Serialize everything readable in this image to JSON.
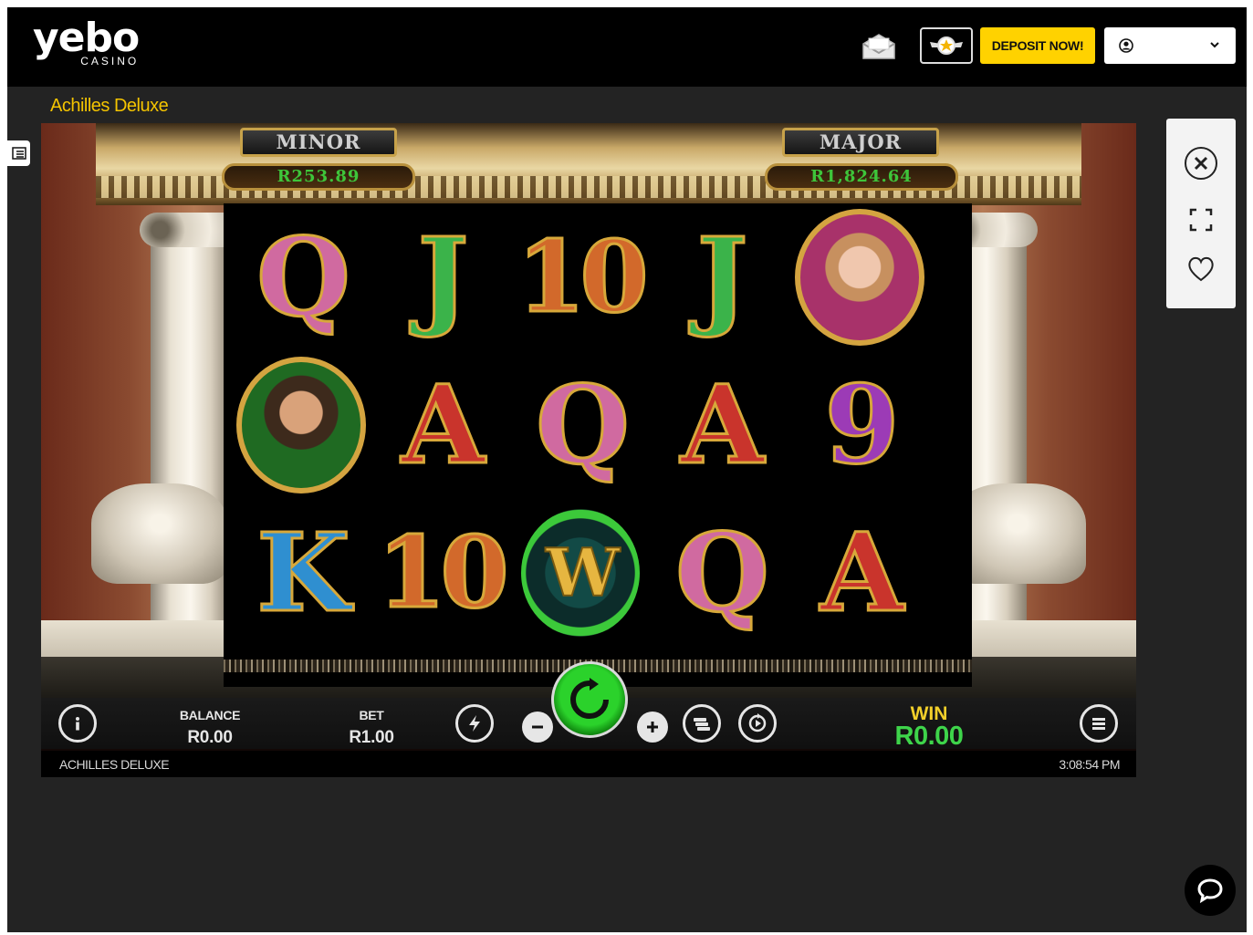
{
  "header": {
    "logo_text": "yebo",
    "logo_sub": "CASINO",
    "deposit_label": "DEPOSIT NOW!",
    "account_value": ""
  },
  "page": {
    "game_title": "Achilles Deluxe"
  },
  "game": {
    "jackpots": {
      "minor_label": "MINOR",
      "minor_value": "R253.89",
      "major_label": "MAJOR",
      "major_value": "R1,824.64"
    },
    "reels": [
      [
        {
          "type": "letter",
          "value": "Q"
        },
        {
          "type": "letter",
          "value": "J"
        },
        {
          "type": "letter",
          "value": "10"
        },
        {
          "type": "letter",
          "value": "J"
        },
        {
          "type": "portrait",
          "value": "woman-portrait"
        }
      ],
      [
        {
          "type": "portrait",
          "value": "achilles-portrait"
        },
        {
          "type": "letter",
          "value": "A"
        },
        {
          "type": "letter",
          "value": "Q"
        },
        {
          "type": "letter",
          "value": "A"
        },
        {
          "type": "letter",
          "value": "9"
        }
      ],
      [
        {
          "type": "letter",
          "value": "K"
        },
        {
          "type": "letter",
          "value": "10"
        },
        {
          "type": "wild",
          "value": "W"
        },
        {
          "type": "letter",
          "value": "Q"
        },
        {
          "type": "letter",
          "value": "A"
        }
      ]
    ],
    "controls": {
      "balance_label": "BALANCE",
      "balance_value": "R0.00",
      "bet_label": "BET",
      "bet_value": "R1.00",
      "win_label": "WIN",
      "win_value": "R0.00"
    },
    "footer": {
      "name": "ACHILLES DELUXE",
      "time": "3:08:54 PM"
    }
  },
  "colors": {
    "accent_yellow": "#ffd200",
    "title_yellow": "#f4c400",
    "spin_green": "#2bd22b",
    "win_green": "#3ed44a",
    "jackpot_green": "#3ec53a"
  }
}
